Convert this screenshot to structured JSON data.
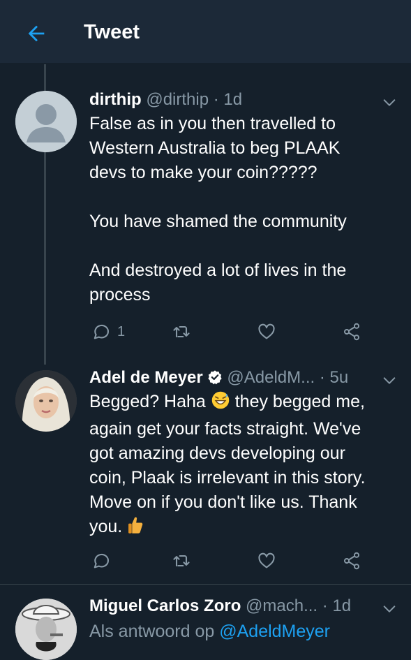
{
  "header": {
    "title": "Tweet"
  },
  "tweets": [
    {
      "name": "dirthip",
      "handle": "@dirthip",
      "dot": "·",
      "time": "1d",
      "text": "False as in you then travelled to\nWestern Australia to beg PLAAK\ndevs to make your coin?????\n\nYou have shamed the community\n\nAnd destroyed a lot of lives in the\nprocess",
      "reply_count": "1"
    },
    {
      "name": "Adel de Meyer",
      "handle": "@AdeldM...",
      "dot": "·",
      "time": "5u",
      "text_1": "Begged? Haha",
      "text_2": "they begged me,\nagain get your facts straight. We've\ngot amazing devs developing our\ncoin, Plaak is irrelevant in this story.\nMove on if you don't like us. Thank\nyou.",
      "emoji_1": "grinning-sweat-emoji",
      "emoji_2": "thumbs-up-emoji"
    },
    {
      "name": "Miguel Carlos Zoro",
      "handle": "@mach...",
      "dot": "·",
      "time": "1d",
      "reply_prefix": "Als antwoord op",
      "reply_mention": "@AdeldMeyer"
    }
  ],
  "colors": {
    "background": "#15202b",
    "header": "#1c2938",
    "accent": "#1da1f2",
    "muted": "#8899a6",
    "divider": "#38444d"
  },
  "icons": [
    "back-arrow-icon",
    "chevron-down-icon",
    "reply-icon",
    "retweet-icon",
    "like-icon",
    "share-icon",
    "verified-badge-icon"
  ]
}
